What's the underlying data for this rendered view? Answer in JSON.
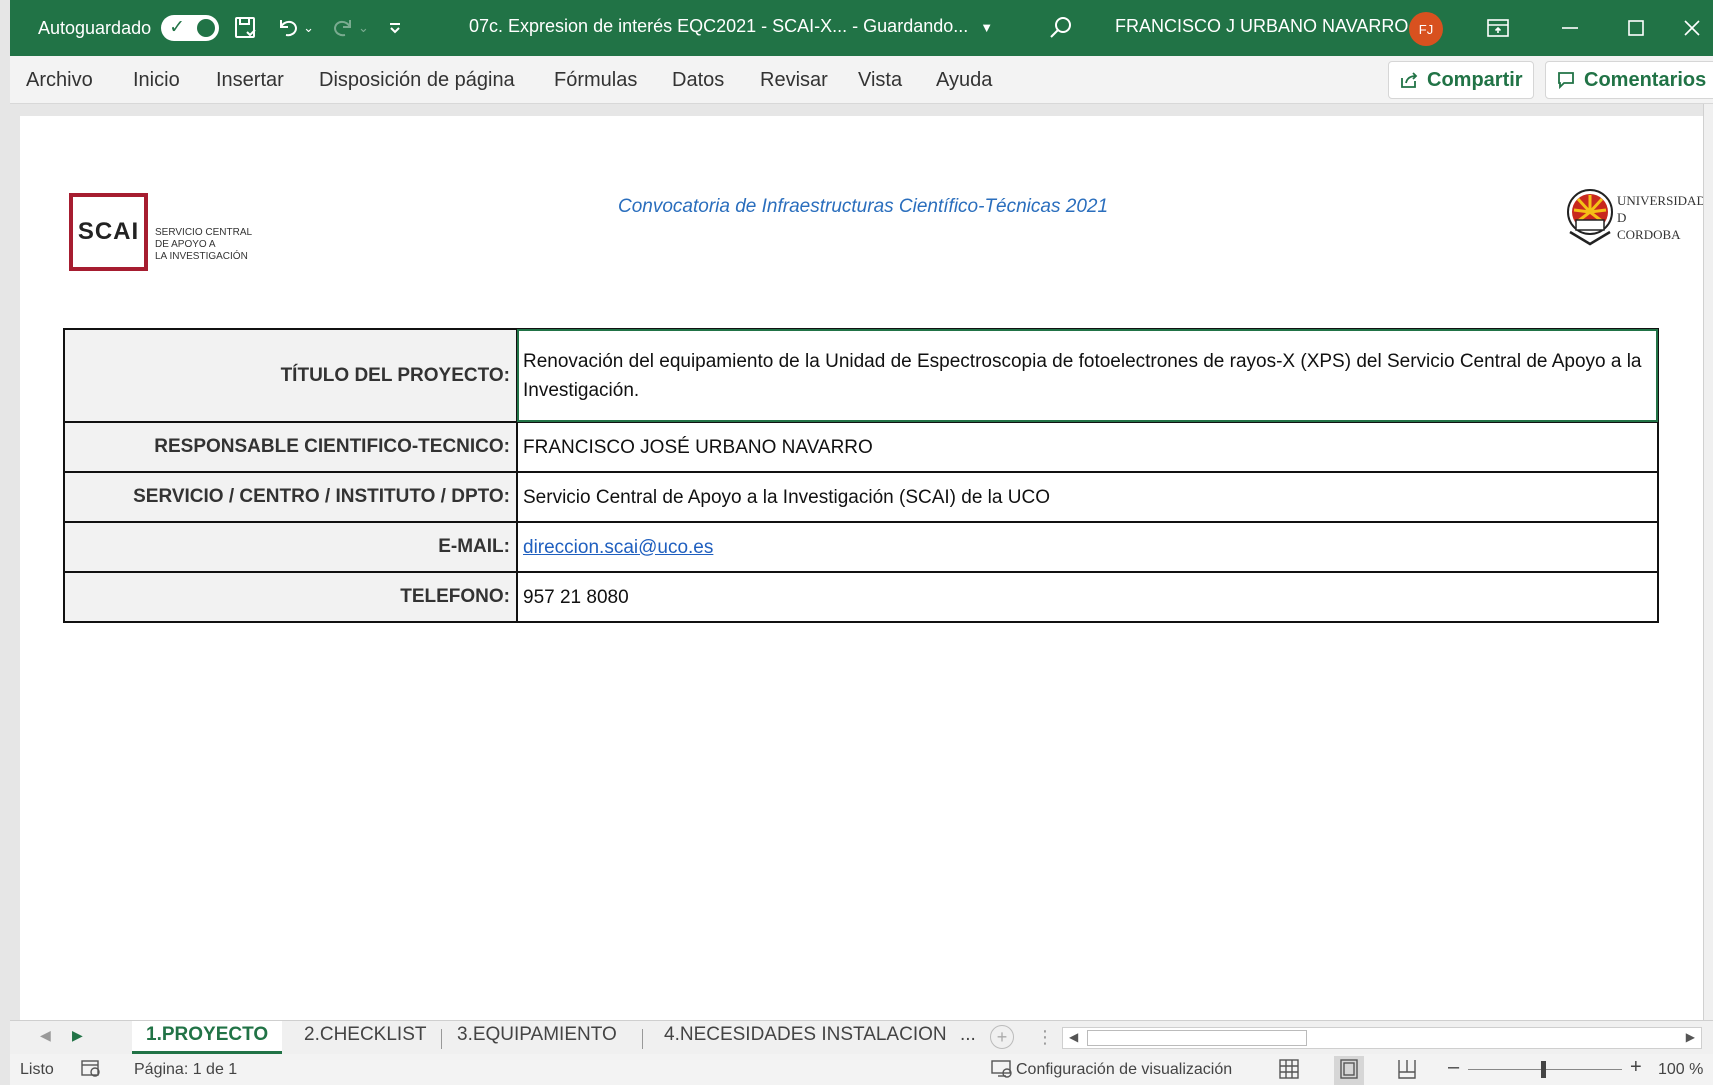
{
  "titlebar": {
    "autosave_label": "Autoguardado",
    "document_title": "07c. Expresion de interés EQC2021 - SCAI-X...  -  Guardando...",
    "user_name": "FRANCISCO J URBANO NAVARRO",
    "user_initials": "FJ"
  },
  "menu": {
    "items": [
      "Archivo",
      "Inicio",
      "Insertar",
      "Disposición de página",
      "Fórmulas",
      "Datos",
      "Revisar",
      "Vista",
      "Ayuda"
    ],
    "share_label": "Compartir",
    "comments_label": "Comentarios"
  },
  "sheet": {
    "subtitle": "Convocatoria de Infraestructuras Científico-Técnicas 2021",
    "scai_logo": {
      "mark": "SCAI",
      "lines": [
        "SERVICIO CENTRAL",
        "DE APOYO A",
        "LA INVESTIGACIÓN"
      ]
    },
    "uco_logo": {
      "lines": [
        "UNIVERSIDAD",
        "D",
        "CORDOBA"
      ]
    },
    "rows": [
      {
        "label": "TÍTULO DEL PROYECTO:",
        "value": "Renovación del equipamiento de la Unidad de Espectroscopia de fotoelectrones de rayos-X (XPS) del Servicio Central de Apoyo a la Investigación."
      },
      {
        "label": "RESPONSABLE CIENTIFICO-TECNICO:",
        "value": "FRANCISCO JOSÉ URBANO NAVARRO"
      },
      {
        "label": "SERVICIO / CENTRO / INSTITUTO / DPTO:",
        "value": "Servicio Central de Apoyo a la Investigación (SCAI) de la UCO"
      },
      {
        "label": "E-MAIL:",
        "value": "direccion.scai@uco.es"
      },
      {
        "label": "TELEFONO:",
        "value": "957 21 8080"
      }
    ]
  },
  "tabs": {
    "items": [
      "1.PROYECTO",
      "2.CHECKLIST",
      "3.EQUIPAMIENTO",
      "4.NECESIDADES INSTALACION"
    ],
    "overflow": "..."
  },
  "status": {
    "ready": "Listo",
    "page": "Página: 1 de 1",
    "display_settings": "Configuración de visualización",
    "zoom": "100 %"
  },
  "colors": {
    "excel_green": "#217346",
    "scai_red": "#a61d30",
    "link_blue": "#1f5fbf",
    "subtitle_blue": "#2a6ebd",
    "avatar_orange": "#d8511f"
  }
}
